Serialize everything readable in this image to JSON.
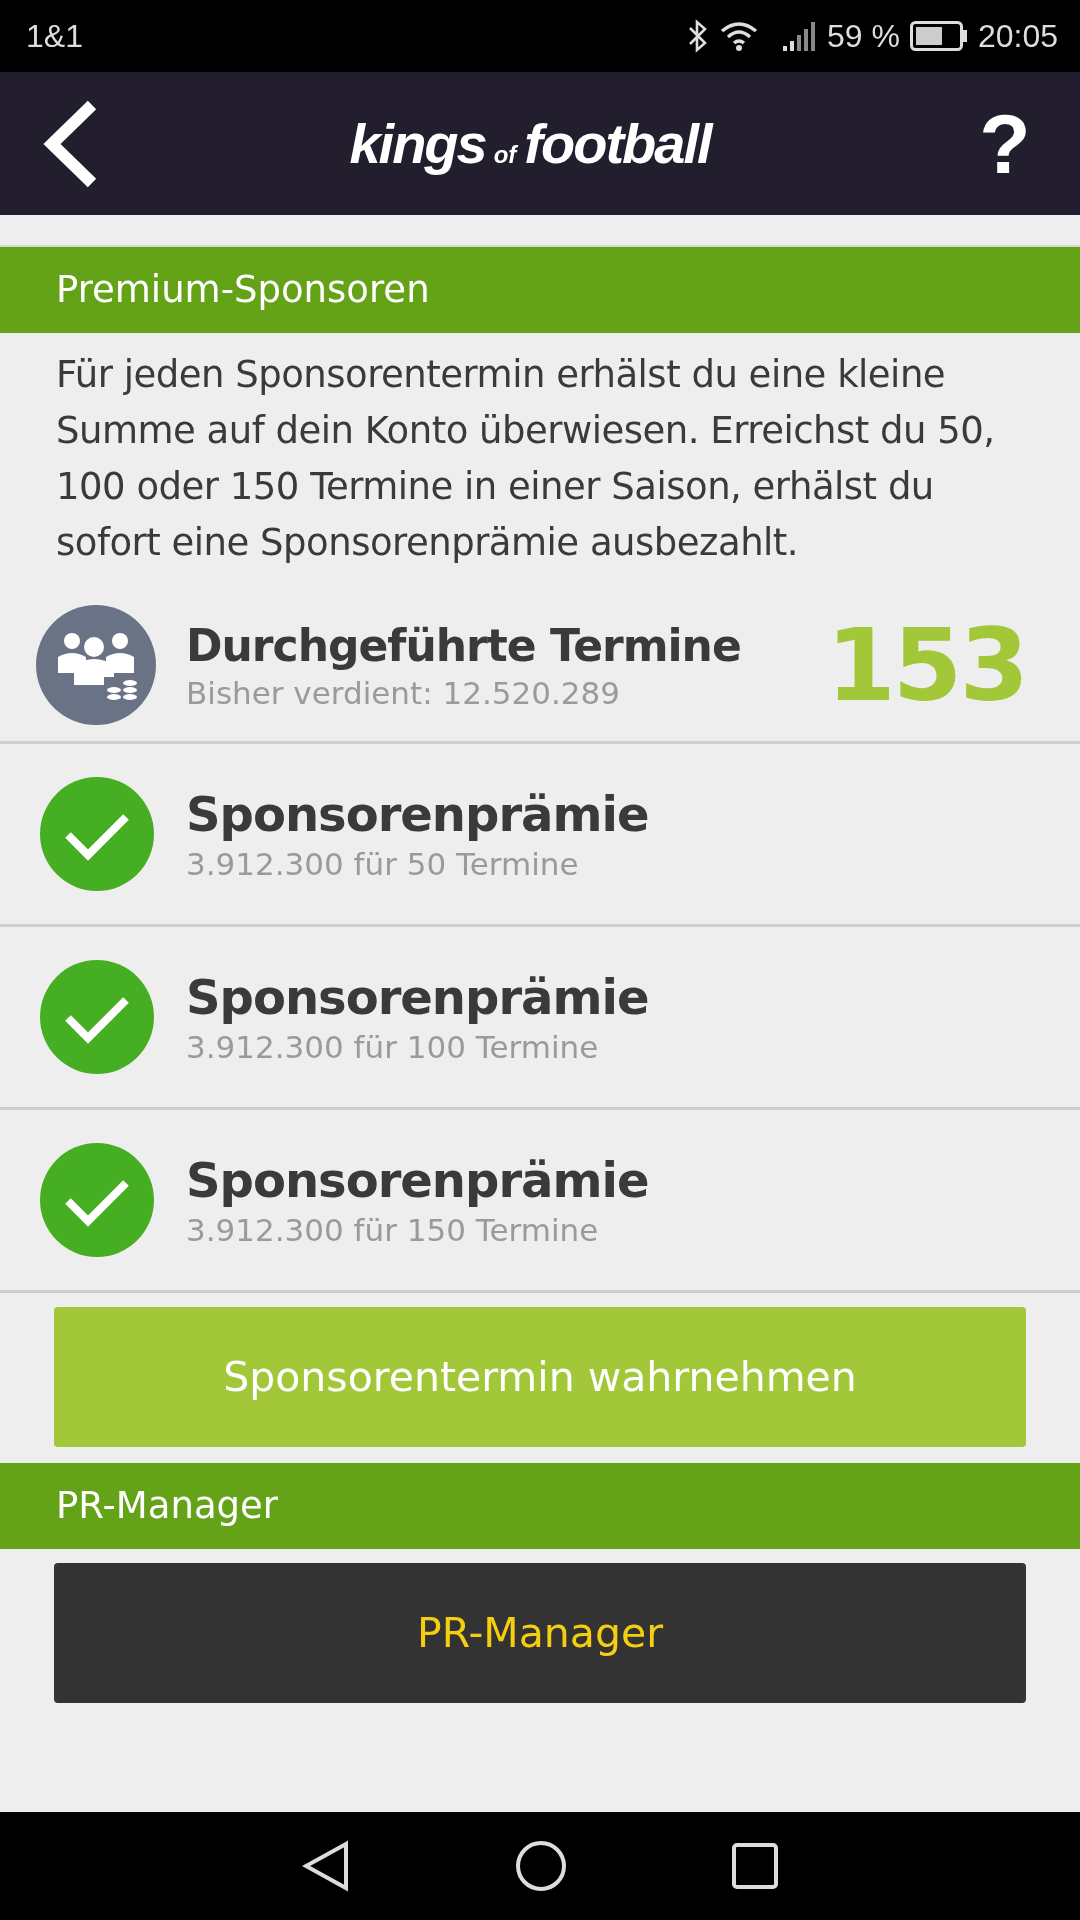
{
  "status_bar": {
    "carrier": "1&1",
    "battery_percent": "59 %",
    "time": "20:05"
  },
  "header": {
    "logo": [
      "kings",
      "of",
      "football"
    ],
    "help": "?"
  },
  "sections": [
    {
      "title": "Premium-Sponsoren",
      "description": "Für jeden Sponsorentermin erhälst du eine kleine Summe auf dein Konto überwiesen. Erreichst du 50, 100 oder 150 Termine in einer Saison, erhälst du sofort eine Sponsorenprämie ausbezahlt.",
      "stat": {
        "title": "Durchgeführte Termine",
        "subtitle": "Bisher verdient: 12.520.289",
        "value": "153"
      },
      "awards": [
        {
          "title": "Sponsorenprämie",
          "subtitle": "3.912.300 für 50 Termine",
          "achieved": true
        },
        {
          "title": "Sponsorenprämie",
          "subtitle": "3.912.300 für 100 Termine",
          "achieved": true
        },
        {
          "title": "Sponsorenprämie",
          "subtitle": "3.912.300 für 150 Termine",
          "achieved": true
        }
      ],
      "button": {
        "label": "Sponsorentermin wahrnehmen",
        "kind": "primary"
      }
    },
    {
      "title": "PR-Manager",
      "button": {
        "label": "PR-Manager",
        "kind": "dark"
      }
    }
  ]
}
